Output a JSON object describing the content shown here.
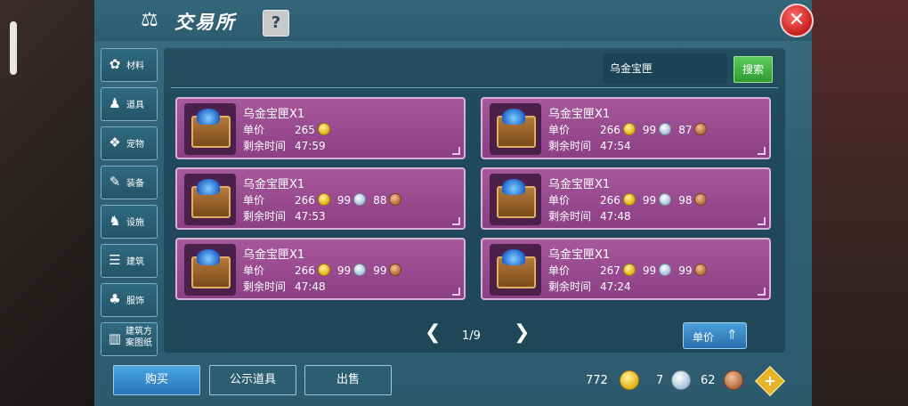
{
  "window": {
    "title": "交易所",
    "help_label": "?",
    "close_label": "✕",
    "title_icon": "scales-icon"
  },
  "sidebar": {
    "items": [
      {
        "label": "材料",
        "icon": "materials-icon",
        "glyph": "✿"
      },
      {
        "label": "道具",
        "icon": "item-icon",
        "glyph": "♟"
      },
      {
        "label": "宠物",
        "icon": "paw-icon",
        "glyph": "❖"
      },
      {
        "label": "装备",
        "icon": "equipment-icon",
        "glyph": "✎"
      },
      {
        "label": "设施",
        "icon": "facility-icon",
        "glyph": "♞"
      },
      {
        "label": "建筑",
        "icon": "building-icon",
        "glyph": "☰"
      },
      {
        "label": "服饰",
        "icon": "clothing-icon",
        "glyph": "♣"
      },
      {
        "label": "建筑方案图纸",
        "icon": "blueprint-icon",
        "glyph": "▥"
      }
    ]
  },
  "search": {
    "value": "乌金宝匣",
    "button_label": "搜索"
  },
  "listings": [
    {
      "name": "乌金宝匣X1",
      "price_label": "单价",
      "gold": "265",
      "silver": "",
      "copper": "",
      "time_label": "剩余时间",
      "time": "47:59"
    },
    {
      "name": "乌金宝匣X1",
      "price_label": "单价",
      "gold": "266",
      "silver": "99",
      "copper": "87",
      "time_label": "剩余时间",
      "time": "47:54"
    },
    {
      "name": "乌金宝匣X1",
      "price_label": "单价",
      "gold": "266",
      "silver": "99",
      "copper": "88",
      "time_label": "剩余时间",
      "time": "47:53"
    },
    {
      "name": "乌金宝匣X1",
      "price_label": "单价",
      "gold": "266",
      "silver": "99",
      "copper": "98",
      "time_label": "剩余时间",
      "time": "47:48"
    },
    {
      "name": "乌金宝匣X1",
      "price_label": "单价",
      "gold": "266",
      "silver": "99",
      "copper": "99",
      "time_label": "剩余时间",
      "time": "47:48"
    },
    {
      "name": "乌金宝匣X1",
      "price_label": "单价",
      "gold": "267",
      "silver": "99",
      "copper": "99",
      "time_label": "剩余时间",
      "time": "47:24"
    }
  ],
  "pager": {
    "text": "1/9",
    "prev": "❮",
    "next": "❯"
  },
  "sort": {
    "label": "单价",
    "icon": "sort-up-icon",
    "glyph": "⇑"
  },
  "bottom_buttons": {
    "buy": "购买",
    "public": "公示道具",
    "sell": "出售"
  },
  "currency": {
    "gold": "772",
    "silver": "7",
    "copper": "62",
    "add_label": "+"
  },
  "colors": {
    "panel": "#2f6075",
    "card": "#9a4b92",
    "search_button": "#3fae3f",
    "buy_button": "#3a8dd0",
    "close": "#d62a2a"
  }
}
